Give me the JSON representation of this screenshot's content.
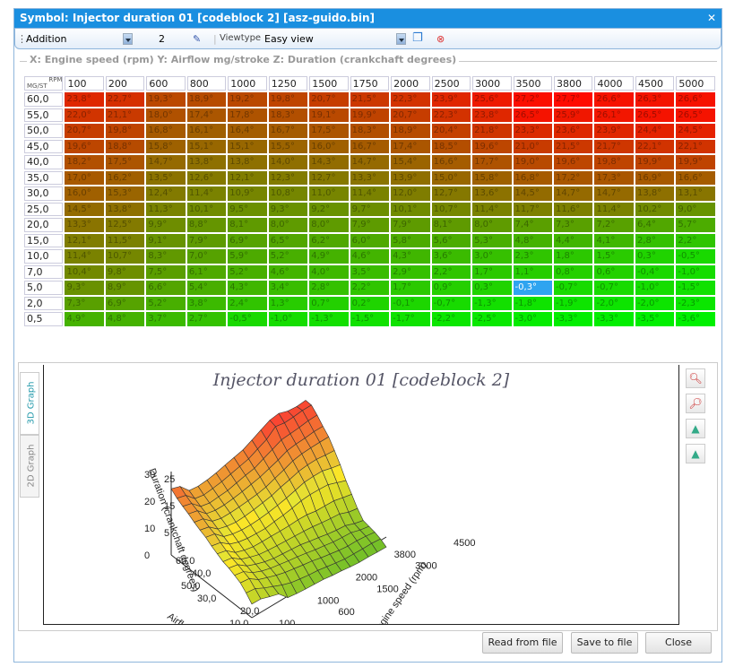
{
  "window": {
    "title": "Symbol: Injector duration 01 [codeblock 2] [asz-guido.bin]",
    "close_icon": "close-icon"
  },
  "toolbar": {
    "mode": "Addition",
    "value": "2",
    "viewtype_label": "Viewtype",
    "viewtype": "Easy view"
  },
  "group_label": "X: Engine speed (rpm) Y: Airflow mg/stroke Z: Duration (crankchaft degrees)",
  "table": {
    "corner_top": "RPM",
    "corner_bottom": "MG/ST",
    "columns": [
      "100",
      "200",
      "600",
      "800",
      "1000",
      "1250",
      "1500",
      "1750",
      "2000",
      "2500",
      "3000",
      "3500",
      "3800",
      "4000",
      "4500",
      "5000"
    ],
    "rows": [
      "60,0",
      "55,0",
      "50,0",
      "45,0",
      "40,0",
      "35,0",
      "30,0",
      "25,0",
      "20,0",
      "15,0",
      "10,0",
      "7,0",
      "5,0",
      "2,0",
      "0,5"
    ],
    "values": [
      [
        23.8,
        22.7,
        19.3,
        18.9,
        19.2,
        19.8,
        20.7,
        21.5,
        22.3,
        23.9,
        25.6,
        27.2,
        27.7,
        26.6,
        26.3,
        26.6
      ],
      [
        22.0,
        21.1,
        18.0,
        17.4,
        17.8,
        18.3,
        19.1,
        19.9,
        20.7,
        22.3,
        23.8,
        26.5,
        25.9,
        26.1,
        26.5,
        26.5
      ],
      [
        20.7,
        19.8,
        16.8,
        16.1,
        16.4,
        16.7,
        17.5,
        18.3,
        18.9,
        20.4,
        21.8,
        23.3,
        23.6,
        23.9,
        24.4,
        24.5
      ],
      [
        19.6,
        18.8,
        15.8,
        15.1,
        15.1,
        15.5,
        16.0,
        16.7,
        17.4,
        18.5,
        19.6,
        21.0,
        21.5,
        21.7,
        22.1,
        22.1
      ],
      [
        18.2,
        17.5,
        14.7,
        13.8,
        13.8,
        14.0,
        14.3,
        14.7,
        15.4,
        16.6,
        17.7,
        19.0,
        19.6,
        19.8,
        19.9,
        19.9
      ],
      [
        17.0,
        16.2,
        13.5,
        12.6,
        12.1,
        12.3,
        12.7,
        13.3,
        13.9,
        15.0,
        15.8,
        16.8,
        17.2,
        17.3,
        16.9,
        16.6
      ],
      [
        16.0,
        15.3,
        12.4,
        11.4,
        10.9,
        10.8,
        11.0,
        11.4,
        12.0,
        12.7,
        13.6,
        14.5,
        14.7,
        14.7,
        13.8,
        13.1
      ],
      [
        14.5,
        13.8,
        11.3,
        10.1,
        9.5,
        9.3,
        9.2,
        9.7,
        10.1,
        10.7,
        11.4,
        11.7,
        11.6,
        11.4,
        10.2,
        9.0
      ],
      [
        13.3,
        12.5,
        9.9,
        8.8,
        8.1,
        8.0,
        8.0,
        7.9,
        7.9,
        8.1,
        8.0,
        7.4,
        7.3,
        7.2,
        6.4,
        5.7
      ],
      [
        12.1,
        11.5,
        9.1,
        7.9,
        6.9,
        6.5,
        6.2,
        6.0,
        5.8,
        5.6,
        5.3,
        4.8,
        4.4,
        4.1,
        2.8,
        2.2
      ],
      [
        11.4,
        10.7,
        8.3,
        7.0,
        5.9,
        5.2,
        4.9,
        4.6,
        4.3,
        3.6,
        3.0,
        2.3,
        1.8,
        1.5,
        0.3,
        -0.5
      ],
      [
        10.4,
        9.8,
        7.5,
        6.1,
        5.2,
        4.6,
        4.0,
        3.5,
        2.9,
        2.2,
        1.7,
        1.1,
        0.8,
        0.6,
        -0.4,
        -1.0
      ],
      [
        9.3,
        8.9,
        6.6,
        5.4,
        4.3,
        3.4,
        2.8,
        2.2,
        1.7,
        0.9,
        0.3,
        -0.3,
        -0.7,
        -0.7,
        -1.0,
        -1.5
      ],
      [
        7.3,
        6.9,
        5.2,
        3.8,
        2.4,
        1.3,
        0.7,
        0.2,
        -0.1,
        -0.7,
        -1.3,
        -1.8,
        -1.9,
        -2.0,
        -2.0,
        -2.3
      ],
      [
        4.9,
        4.8,
        3.7,
        2.7,
        -0.5,
        -1.0,
        -1.3,
        -1.5,
        -1.7,
        -2.2,
        -2.5,
        -3.0,
        -3.3,
        -3.3,
        -3.5,
        -3.6
      ]
    ],
    "unit": "°",
    "selected_cell": {
      "row": "5,0",
      "column": "3500"
    },
    "colors": {
      "low": "#00f000",
      "high": "#ff0000",
      "selected": "#2fa4f0"
    }
  },
  "graph": {
    "tabs": [
      "3D Graph",
      "2D Graph"
    ],
    "active_tab": "3D Graph",
    "title": "Injector duration 01 [codeblock 2]",
    "z_label": "Duration (crankchaft degrees)",
    "y_label": "Airflow mg/stroke",
    "x_label": "Engine speed (rpm)",
    "z_ticks": [
      "0",
      "5",
      "10",
      "15",
      "20",
      "25",
      "30"
    ],
    "y_ticks": [
      "60,0",
      "50,0",
      "40,0",
      "30,0",
      "20,0",
      "10,0",
      "5,0"
    ],
    "x_ticks": [
      "100",
      "600",
      "1000",
      "1500",
      "2000",
      "3000",
      "3800",
      "4500"
    ],
    "tools": [
      "zoom-in-icon",
      "zoom-out-icon",
      "rotate-left-icon",
      "rotate-right-icon"
    ]
  },
  "buttons": {
    "read": "Read from file",
    "save": "Save to file",
    "close": "Close"
  }
}
